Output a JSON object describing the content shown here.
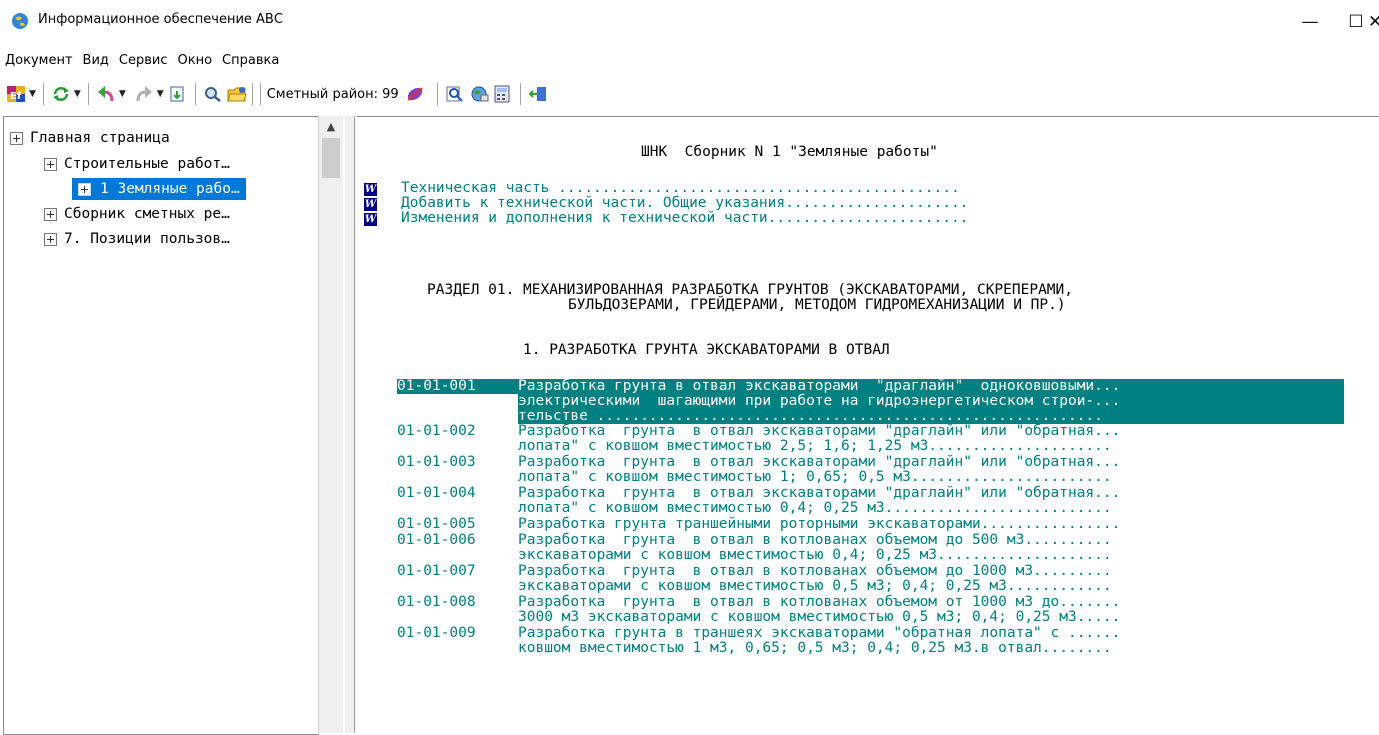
{
  "window": {
    "title": "Информационное обеспечение АВС",
    "minimize": "—",
    "maximize": "☐",
    "close": "✕"
  },
  "menu": [
    "Документ",
    "Вид",
    "Сервис",
    "Окно",
    "Справка"
  ],
  "toolbar": {
    "region_label": "Сметный район: 99",
    "icons": [
      "color-table-icon",
      "refresh-icon",
      "back-icon",
      "forward-icon",
      "export-icon",
      "find-icon",
      "open-folder-icon",
      "region-icon",
      "search-icon",
      "globe-icon",
      "calculator-icon",
      "exit-icon"
    ]
  },
  "tree": {
    "items": [
      {
        "label": "Главная страница"
      },
      {
        "label": "Строительные работ…"
      },
      {
        "label": "1 Земляные рабо…"
      },
      {
        "label": "Сборник сметных ре…"
      },
      {
        "label": "7. Позиции пользов…"
      }
    ]
  },
  "document": {
    "title": "ШНК  Сборник N 1 \"Земляные работы\"",
    "links": [
      "Техническая часть ..............................................",
      "Добавить к технической части. Общие указания.....................",
      "Изменения и дополнения к технической части......................."
    ],
    "section_line1": "РАЗДЕЛ 01. МЕХАНИЗИРОВАННАЯ РАЗРАБОТКА ГРУНТОВ (ЭКСКАВАТОРАМИ, СКРЕПЕРАМИ,",
    "section_line2": "БУЛЬДОЗЕРАМИ, ГРЕЙДЕРАМИ, МЕТОДОМ ГИДРОМЕХАНИЗАЦИИ И ПР.)",
    "subsection": "1. РАЗРАБОТКА ГРУНТА ЭКСКАВАТОРАМИ В ОТВАЛ",
    "entries": [
      {
        "code": "01-01-001",
        "lines": [
          "Разработка грунта в отвал экскаваторами  \"драглайн\"  одноковшовыми...",
          "электрическими  шагающими при работе на гидроэнергетическом строи-...",
          "тельстве .........................................................."
        ]
      },
      {
        "code": "01-01-002",
        "lines": [
          "Разработка  грунта  в отвал экскаваторами \"драглайн\" или \"обратная...",
          "лопата\" с ковшом вместимостью 2,5; 1,6; 1,25 м3....................."
        ]
      },
      {
        "code": "01-01-003",
        "lines": [
          "Разработка  грунта  в отвал экскаваторами \"драглайн\" или \"обратная...",
          "лопата\" с ковшом вместимостью 1; 0,65; 0,5 м3......................."
        ]
      },
      {
        "code": "01-01-004",
        "lines": [
          "Разработка  грунта  в отвал экскаваторами \"драглайн\" или \"обратная...",
          "лопата\" с ковшом вместимостью 0,4; 0,25 м3.........................."
        ]
      },
      {
        "code": "01-01-005",
        "lines": [
          "Разработка грунта траншейными роторными экскаваторами................"
        ]
      },
      {
        "code": "01-01-006",
        "lines": [
          "Разработка  грунта  в отвал в котлованах объемом до 500 м3..........",
          "экскаваторами с ковшом вместимостью 0,4; 0,25 м3...................."
        ]
      },
      {
        "code": "01-01-007",
        "lines": [
          "Разработка  грунта  в отвал в котлованах объемом до 1000 м3.........",
          "экскаваторами с ковшом вместимостью 0,5 м3; 0,4; 0,25 м3............"
        ]
      },
      {
        "code": "01-01-008",
        "lines": [
          "Разработка  грунта  в отвал в котлованах объемом от 1000 м3 до.......",
          "3000 м3 экскаваторами с ковшом вместимостью 0,5 м3; 0,4; 0,25 м3....."
        ]
      },
      {
        "code": "01-01-009",
        "lines": [
          "Разработка грунта в траншеях экскаваторами \"обратная лопата\" с ......",
          "ковшом вместимостью 1 м3, 0,65; 0,5 м3; 0,4; 0,25 м3.в отвал........"
        ]
      }
    ]
  }
}
